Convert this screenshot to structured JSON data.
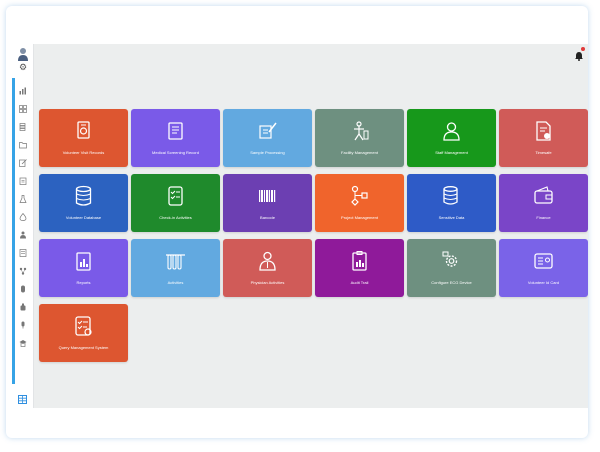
{
  "colors": {
    "red_orange": "#dd5630",
    "purple": "#7a5ae8",
    "light_blue": "#62a9e0",
    "sage": "#6e9080",
    "green": "#17981b",
    "salmon": "#d05b58",
    "navy_blue": "#2c62c0",
    "dark_green": "#1f8a2c",
    "indigo": "#6c3fb2",
    "orange": "#f0642c",
    "royal_blue": "#2e5bc7",
    "violet": "#7a45c8",
    "magenta": "#8f1a9a",
    "periwinkle": "#7a63e8",
    "rail_blue": "#36a3e6"
  },
  "tiles": [
    {
      "label": "Volunteer Visit Records",
      "icon": "id-document-icon",
      "color": "#dd5630"
    },
    {
      "label": "Medical Screening Record",
      "icon": "clipboard-record-icon",
      "color": "#7a5ae8"
    },
    {
      "label": "Sample Processing",
      "icon": "sample-processing-icon",
      "color": "#62a9e0"
    },
    {
      "label": "Facility Management",
      "icon": "facility-person-icon",
      "color": "#6e9080"
    },
    {
      "label": "Staff Management",
      "icon": "staff-user-icon",
      "color": "#17981b"
    },
    {
      "label": "Timesafe",
      "icon": "document-check-icon",
      "color": "#d05b58"
    },
    {
      "label": "Volunteer Database",
      "icon": "database-icon",
      "color": "#2c62c0"
    },
    {
      "label": "Check-in Activities",
      "icon": "checklist-icon",
      "color": "#1f8a2c"
    },
    {
      "label": "Barcode",
      "icon": "barcode-icon",
      "color": "#6c3fb2"
    },
    {
      "label": "Project Management",
      "icon": "project-flow-icon",
      "color": "#f0642c"
    },
    {
      "label": "Sensitive Data",
      "icon": "database-lock-icon",
      "color": "#2e5bc7"
    },
    {
      "label": "Finance",
      "icon": "wallet-icon",
      "color": "#7a45c8"
    },
    {
      "label": "Reports",
      "icon": "report-chart-icon",
      "color": "#7a5ae8"
    },
    {
      "label": "Activities",
      "icon": "test-tubes-icon",
      "color": "#62a9e0"
    },
    {
      "label": "Physician Activities",
      "icon": "physician-icon",
      "color": "#d05b58"
    },
    {
      "label": "Audit Trail",
      "icon": "audit-clipboard-icon",
      "color": "#8f1a9a"
    },
    {
      "label": "Configure ECG Device",
      "icon": "config-gear-icon",
      "color": "#6e9080"
    },
    {
      "label": "Volunteer Id Card",
      "icon": "id-card-icon",
      "color": "#7a63e8"
    },
    {
      "label": "Query Management System",
      "icon": "query-checklist-icon",
      "color": "#dd5630"
    }
  ],
  "sidebar": {
    "icons": [
      "bar-chart-icon",
      "grid-icon",
      "stack-icon",
      "folder-icon",
      "edit-icon",
      "clipboard-icon",
      "flask-icon",
      "drop-icon",
      "person-icon",
      "list-icon",
      "nodes-icon",
      "pill-icon",
      "bottle-icon",
      "mic-icon",
      "cap-icon"
    ],
    "bottom_icon": "table-icon"
  },
  "header": {
    "avatar_icon": "user-avatar-icon",
    "settings_icon": "gear-icon",
    "notification_icon": "bell-icon"
  }
}
